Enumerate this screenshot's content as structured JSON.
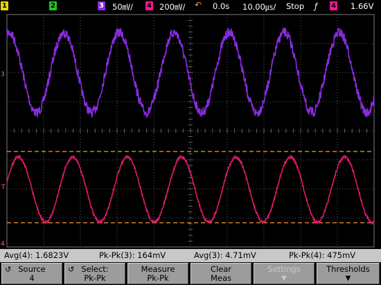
{
  "status_bar": {
    "channels": [
      {
        "number": "1",
        "color": "#e6d800"
      },
      {
        "number": "2",
        "color": "#22c322"
      },
      {
        "number": "3",
        "color": "#8a2be2",
        "scale": "50㎷/"
      },
      {
        "number": "4",
        "color": "#ff1493",
        "scale": "200㎷/"
      }
    ],
    "time_offset": "0.0s",
    "timebase": "10.00㎲/",
    "run_state": "Stop",
    "trigger_channel": "4",
    "trigger_level": "1.66V"
  },
  "markers": {
    "ch3": "3",
    "trigger": "T",
    "ch4": "4"
  },
  "colors": {
    "ch3": "#8a2be2",
    "ch4": "#e0186e",
    "threshold": "#ff9a30",
    "grid": "#7a7a7a"
  },
  "measurements": [
    "Avg(4): 1.6823V",
    "Pk-Pk(3): 164mV",
    "Avg(3): 4.71mV",
    "Pk-Pk(4): 475mV"
  ],
  "softkeys": [
    {
      "line1": "Source",
      "line2": "4"
    },
    {
      "line1": "Select:",
      "line2": "Pk-Pk"
    },
    {
      "line1": "Measure",
      "line2": "Pk-Pk"
    },
    {
      "line1": "Clear",
      "line2": "Meas"
    },
    {
      "line1": "Settings",
      "line2": ""
    },
    {
      "line1": "Thresholds",
      "line2": ""
    }
  ]
}
